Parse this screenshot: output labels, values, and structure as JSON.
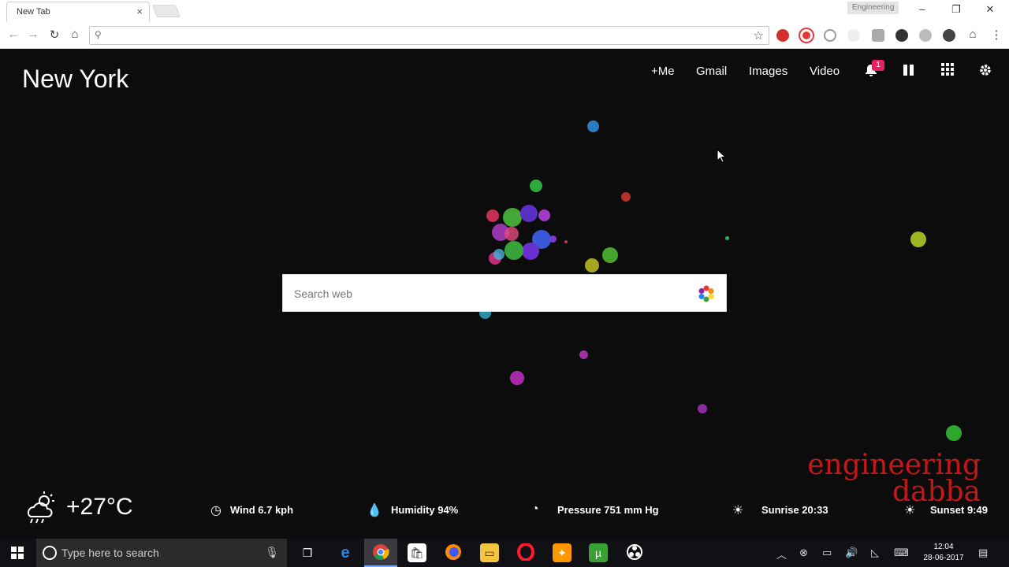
{
  "browser": {
    "tab_title": "New Tab",
    "tab_close": "×",
    "profile_name": "Engineering",
    "window_controls": {
      "minimize": "–",
      "restore": "❐",
      "close": "✕"
    },
    "nav": {
      "back": "←",
      "forward": "→",
      "reload": "↻",
      "home": "⌂"
    },
    "omnibox_value": "",
    "bookmark_star": "☆",
    "extensions": [
      "extension-red-icon",
      "opera-icon",
      "sync-icon",
      "cloud-icon",
      "extension-badge-icon",
      "speed-icon",
      "extension-gray-icon",
      "shield-icon",
      "home-icon",
      "menu-icon"
    ]
  },
  "page": {
    "city": "New York",
    "nav": {
      "me": "+Me",
      "gmail": "Gmail",
      "images": "Images",
      "video": "Video"
    },
    "notification_count": "1",
    "search_placeholder": "Search web",
    "weather": {
      "temperature": "+27°C",
      "wind": "Wind 6.7 kph",
      "humidity": "Humidity 94%",
      "pressure": "Pressure 751 mm Hg",
      "sunrise": "Sunrise 20:33",
      "sunset": "Sunset 9:49"
    },
    "watermark": {
      "line1": "engineering",
      "line2": "dabba"
    }
  },
  "taskbar": {
    "search_placeholder": "Type here to search",
    "time": "12:04",
    "date": "28-06-2017"
  },
  "colors": {
    "page_bg": "#0c0c0c",
    "watermark": "#c41818",
    "badge": "#e91e63"
  }
}
